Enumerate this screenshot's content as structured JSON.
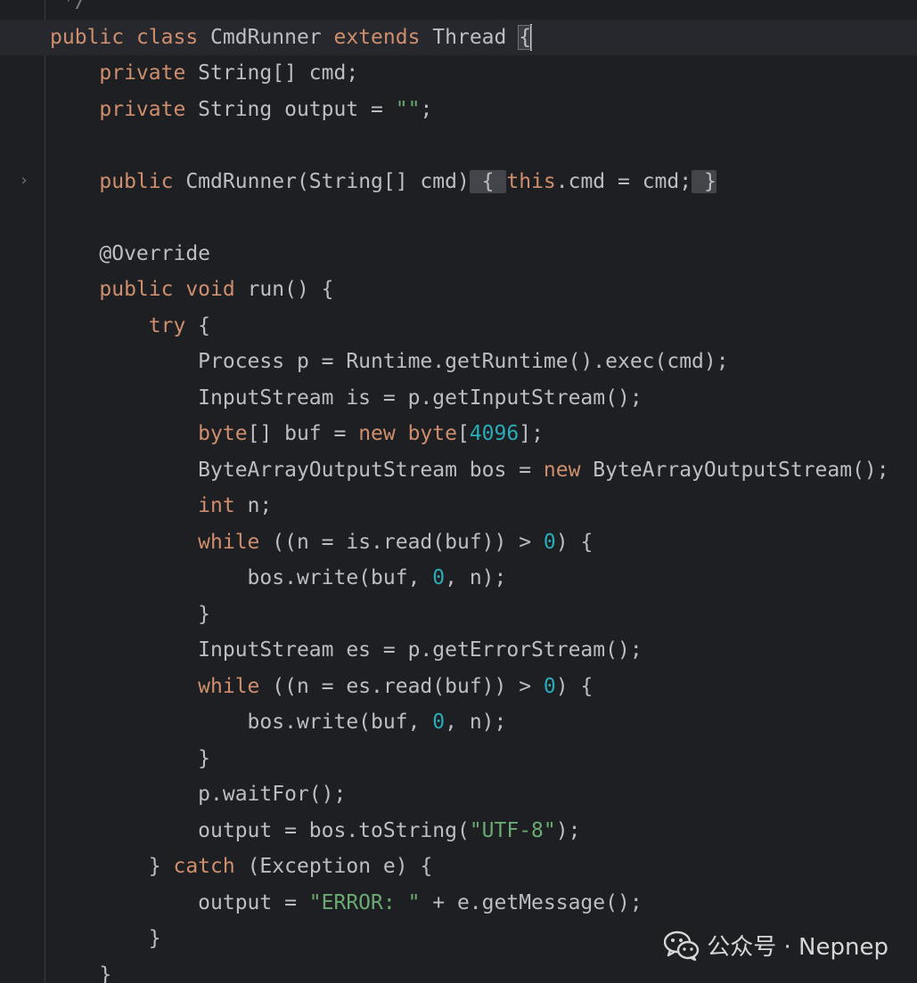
{
  "editor": {
    "language": "java",
    "fold_marker": "›"
  },
  "code": {
    "lines": [
      [
        {
          "t": " */",
          "c": "cmt"
        }
      ],
      [
        {
          "t": "public ",
          "c": "kw"
        },
        {
          "t": "class ",
          "c": "kw"
        },
        {
          "t": "CmdRunner ",
          "c": ""
        },
        {
          "t": "extends ",
          "c": "kw"
        },
        {
          "t": "Thread ",
          "c": ""
        },
        {
          "t": "{",
          "c": "brace-hl"
        }
      ],
      [
        {
          "t": "    ",
          "c": ""
        },
        {
          "t": "private ",
          "c": "kw"
        },
        {
          "t": "String[] cmd;",
          "c": ""
        }
      ],
      [
        {
          "t": "    ",
          "c": ""
        },
        {
          "t": "private ",
          "c": "kw"
        },
        {
          "t": "String output = ",
          "c": ""
        },
        {
          "t": "\"\"",
          "c": "str"
        },
        {
          "t": ";",
          "c": ""
        }
      ],
      [
        {
          "t": "",
          "c": ""
        }
      ],
      [
        {
          "t": "    ",
          "c": ""
        },
        {
          "t": "public ",
          "c": "kw"
        },
        {
          "t": "CmdRunner(String[] cmd)",
          "c": ""
        },
        {
          "t": " { ",
          "c": "fold-bg"
        },
        {
          "t": "this",
          "c": "kw"
        },
        {
          "t": ".cmd = cmd;",
          "c": ""
        },
        {
          "t": " }",
          "c": "fold-bg"
        }
      ],
      [
        {
          "t": "",
          "c": ""
        }
      ],
      [
        {
          "t": "    ",
          "c": ""
        },
        {
          "t": "@Override",
          "c": "ann"
        }
      ],
      [
        {
          "t": "    ",
          "c": ""
        },
        {
          "t": "public ",
          "c": "kw"
        },
        {
          "t": "void ",
          "c": "kw"
        },
        {
          "t": "run() {",
          "c": ""
        }
      ],
      [
        {
          "t": "        ",
          "c": ""
        },
        {
          "t": "try ",
          "c": "kw"
        },
        {
          "t": "{",
          "c": ""
        }
      ],
      [
        {
          "t": "            Process p = Runtime.getRuntime().exec(cmd);",
          "c": ""
        }
      ],
      [
        {
          "t": "            InputStream is = p.getInputStream();",
          "c": ""
        }
      ],
      [
        {
          "t": "            ",
          "c": ""
        },
        {
          "t": "byte",
          "c": "kw"
        },
        {
          "t": "[] buf = ",
          "c": ""
        },
        {
          "t": "new ",
          "c": "kw"
        },
        {
          "t": "byte",
          "c": "kw"
        },
        {
          "t": "[",
          "c": ""
        },
        {
          "t": "4096",
          "c": "num"
        },
        {
          "t": "];",
          "c": ""
        }
      ],
      [
        {
          "t": "            ByteArrayOutputStream bos = ",
          "c": ""
        },
        {
          "t": "new ",
          "c": "kw"
        },
        {
          "t": "ByteArrayOutputStream();",
          "c": ""
        }
      ],
      [
        {
          "t": "            ",
          "c": ""
        },
        {
          "t": "int ",
          "c": "kw"
        },
        {
          "t": "n;",
          "c": ""
        }
      ],
      [
        {
          "t": "            ",
          "c": ""
        },
        {
          "t": "while ",
          "c": "kw"
        },
        {
          "t": "((n = is.read(buf)) > ",
          "c": ""
        },
        {
          "t": "0",
          "c": "num"
        },
        {
          "t": ") {",
          "c": ""
        }
      ],
      [
        {
          "t": "                bos.write(buf, ",
          "c": ""
        },
        {
          "t": "0",
          "c": "num"
        },
        {
          "t": ", n);",
          "c": ""
        }
      ],
      [
        {
          "t": "            }",
          "c": ""
        }
      ],
      [
        {
          "t": "            InputStream es = p.getErrorStream();",
          "c": ""
        }
      ],
      [
        {
          "t": "            ",
          "c": ""
        },
        {
          "t": "while ",
          "c": "kw"
        },
        {
          "t": "((n = es.read(buf)) > ",
          "c": ""
        },
        {
          "t": "0",
          "c": "num"
        },
        {
          "t": ") {",
          "c": ""
        }
      ],
      [
        {
          "t": "                bos.write(buf, ",
          "c": ""
        },
        {
          "t": "0",
          "c": "num"
        },
        {
          "t": ", n);",
          "c": ""
        }
      ],
      [
        {
          "t": "            }",
          "c": ""
        }
      ],
      [
        {
          "t": "            p.waitFor();",
          "c": ""
        }
      ],
      [
        {
          "t": "            output = bos.toString(",
          "c": ""
        },
        {
          "t": "\"UTF-8\"",
          "c": "str"
        },
        {
          "t": ");",
          "c": ""
        }
      ],
      [
        {
          "t": "        } ",
          "c": ""
        },
        {
          "t": "catch ",
          "c": "kw"
        },
        {
          "t": "(Exception e) {",
          "c": ""
        }
      ],
      [
        {
          "t": "            output = ",
          "c": ""
        },
        {
          "t": "\"ERROR: \"",
          "c": "str"
        },
        {
          "t": " + e.getMessage();",
          "c": ""
        }
      ],
      [
        {
          "t": "        }",
          "c": ""
        }
      ],
      [
        {
          "t": "    }",
          "c": ""
        }
      ]
    ]
  },
  "watermark": {
    "text": "公众号 · Nepnep",
    "icon": "wechat-icon"
  }
}
